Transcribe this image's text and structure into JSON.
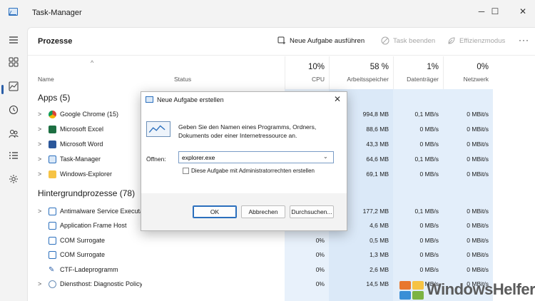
{
  "app": {
    "title": "Task-Manager"
  },
  "window_controls": {
    "minimize": "─",
    "maximize": "☐",
    "close": "✕"
  },
  "page": {
    "title": "Prozesse"
  },
  "toolbar": {
    "new_task": "Neue Aufgabe ausführen",
    "end_task": "Task beenden",
    "efficiency": "Effizienzmodus",
    "more": "···"
  },
  "columns": {
    "name": "Name",
    "status": "Status",
    "cpu": {
      "pct": "10%",
      "label": "CPU"
    },
    "memory": {
      "pct": "58 %",
      "label": "Arbeitsspeicher"
    },
    "disk": {
      "pct": "1%",
      "label": "Datenträger"
    },
    "network": {
      "pct": "0%",
      "label": "Netzwerk"
    }
  },
  "apps_group": {
    "title": "Apps (5)"
  },
  "apps": [
    {
      "name": "Google Chrome (15)",
      "icon": "chrome-icon",
      "cpu": "",
      "memory": "994,8 MB",
      "disk": "0,1 MB/s",
      "network": "0 MBit/s"
    },
    {
      "name": "Microsoft Excel",
      "icon": "excel-icon",
      "cpu": "",
      "memory": "88,6 MB",
      "disk": "0 MB/s",
      "network": "0 MBit/s"
    },
    {
      "name": "Microsoft Word",
      "icon": "word-icon",
      "cpu": "",
      "memory": "43,3 MB",
      "disk": "0 MB/s",
      "network": "0 MBit/s"
    },
    {
      "name": "Task-Manager",
      "icon": "taskmanager-icon",
      "cpu": "",
      "memory": "64,6 MB",
      "disk": "0,1 MB/s",
      "network": "0 MBit/s"
    },
    {
      "name": "Windows-Explorer",
      "icon": "folder-icon",
      "cpu": "",
      "memory": "69,1 MB",
      "disk": "0 MB/s",
      "network": "0 MBit/s"
    }
  ],
  "bg_group": {
    "title": "Hintergrundprozesse (78)"
  },
  "bg": [
    {
      "name": "Antimalware Service Executable",
      "cpu": "",
      "memory": "177,2 MB",
      "disk": "0,1 MB/s",
      "network": "0 MBit/s"
    },
    {
      "name": "Application Frame Host",
      "cpu": "",
      "memory": "4,6 MB",
      "disk": "0 MB/s",
      "network": "0 MBit/s"
    },
    {
      "name": "COM Surrogate",
      "cpu": "0%",
      "memory": "0,5 MB",
      "disk": "0 MB/s",
      "network": "0 MBit/s"
    },
    {
      "name": "COM Surrogate",
      "cpu": "0%",
      "memory": "1,3 MB",
      "disk": "0 MB/s",
      "network": "0 MBit/s"
    },
    {
      "name": "CTF-Ladeprogramm",
      "cpu": "0%",
      "memory": "2,6 MB",
      "disk": "0 MB/s",
      "network": "0 MBit/s"
    },
    {
      "name": "Diensthost: Diagnostic Policy ...",
      "cpu": "0%",
      "memory": "14,5 MB",
      "disk": "0 MB/s",
      "network": "0 MBit/s"
    }
  ],
  "dialog": {
    "title": "Neue Aufgabe erstellen",
    "close": "✕",
    "message": "Geben Sie den Namen eines Programms, Ordners, Dokuments oder einer Internetressource an.",
    "open_label": "Öffnen:",
    "input_value": "explorer.exe",
    "admin_checkbox": "Diese Aufgabe mit Administratorrechten erstellen",
    "ok": "OK",
    "cancel": "Abbrechen",
    "browse": "Durchsuchen..."
  },
  "watermark": {
    "text": "WindowsHelfer"
  },
  "colors": {
    "accent": "#2b6fbd",
    "tint": "#dbe9f8",
    "nav_indicator": "#2b5fa8"
  }
}
